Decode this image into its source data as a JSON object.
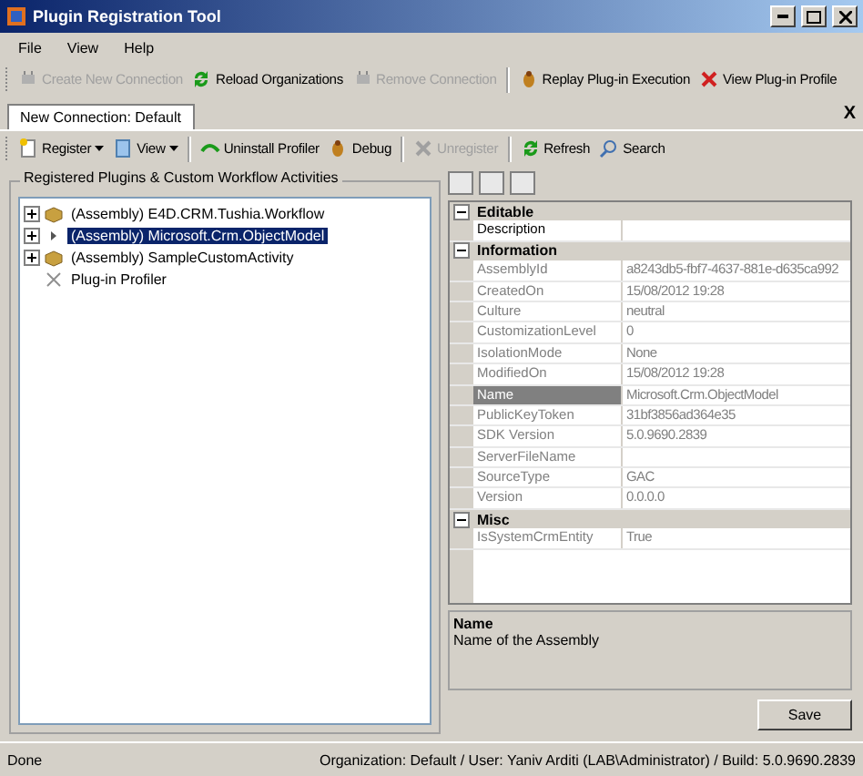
{
  "window": {
    "title": "Plugin Registration Tool"
  },
  "menu": [
    "File",
    "View",
    "Help"
  ],
  "toolbar": [
    {
      "label": "Create New Connection",
      "disabled": true
    },
    {
      "label": "Reload Organizations",
      "disabled": false
    },
    {
      "label": "Remove Connection",
      "disabled": true
    },
    {
      "label": "Replay Plug-in Execution",
      "disabled": false
    },
    {
      "label": "View Plug-in Profile",
      "disabled": false
    }
  ],
  "tabs": [
    {
      "label": "New Connection: Default",
      "selected": true
    }
  ],
  "tab_close": "X",
  "connection_toolbar": [
    {
      "label": "Register",
      "disabled": false,
      "dropdown": true
    },
    {
      "label": "View",
      "disabled": false,
      "dropdown": true
    },
    {
      "label": "Uninstall Profiler",
      "disabled": false,
      "dropdown": false
    },
    {
      "label": "Debug",
      "disabled": false,
      "dropdown": false
    },
    {
      "label": "Unregister",
      "disabled": true,
      "dropdown": false
    },
    {
      "label": "Refresh",
      "disabled": false,
      "dropdown": false
    },
    {
      "label": "Search",
      "disabled": false,
      "dropdown": false
    }
  ],
  "tree": {
    "title": "Registered Plugins & Custom Workflow Activities",
    "items": [
      {
        "label": "(Assembly) E4D.CRM.Tushia.Workflow",
        "kind": "assembly",
        "expanded": false,
        "selected": false
      },
      {
        "label": "(Assembly) Microsoft.Crm.ObjectModel",
        "kind": "assembly",
        "expanded": false,
        "selected": true
      },
      {
        "label": "(Assembly) SampleCustomActivity",
        "kind": "assembly",
        "expanded": false,
        "selected": false
      },
      {
        "label": "Plug-in Profiler",
        "kind": "profiler",
        "selected": false
      }
    ]
  },
  "properties": {
    "categories": [
      {
        "name": "Editable",
        "expanded": true,
        "rows": [
          {
            "name": "Description",
            "readonly": false,
            "selected": false
          }
        ]
      },
      {
        "name": "Information",
        "expanded": true,
        "rows": [
          {
            "name": "AssemblyId",
            "value": "a8243db5-fbf7-4637-881e-d635ca992",
            "readonly": true,
            "selected": false
          },
          {
            "name": "CreatedOn",
            "value": "15/08/2012 19:28",
            "readonly": true,
            "selected": false
          },
          {
            "name": "Culture",
            "value": "neutral",
            "readonly": true,
            "selected": false
          },
          {
            "name": "CustomizationLevel",
            "value": "0",
            "readonly": true,
            "selected": false
          },
          {
            "name": "IsolationMode",
            "value": "None",
            "readonly": true,
            "selected": false
          },
          {
            "name": "ModifiedOn",
            "value": "15/08/2012 19:28",
            "readonly": true,
            "selected": false
          },
          {
            "name": "Name",
            "value": "Microsoft.Crm.ObjectModel",
            "readonly": true,
            "selected": true
          },
          {
            "name": "PublicKeyToken",
            "value": "31bf3856ad364e35",
            "readonly": true,
            "selected": false
          },
          {
            "name": "SDK Version",
            "value": "5.0.9690.2839",
            "readonly": true,
            "selected": false
          },
          {
            "name": "ServerFileName",
            "readonly": true,
            "selected": false
          },
          {
            "name": "SourceType",
            "value": "GAC",
            "readonly": true,
            "selected": false
          },
          {
            "name": "Version",
            "value": "0.0.0.0",
            "readonly": true,
            "selected": false
          }
        ]
      },
      {
        "name": "Misc",
        "expanded": true,
        "rows": [
          {
            "name": "IsSystemCrmEntity",
            "value": "True",
            "readonly": true,
            "selected": false
          }
        ]
      }
    ],
    "description_title": "Name",
    "description_text": "Name of the Assembly"
  },
  "save_button": "Save",
  "status_bar": {
    "left": "Done",
    "right": "Organization: Default / User: Yaniv Arditi (LAB\\Administrator) / Build: 5.0.9690.2839"
  }
}
